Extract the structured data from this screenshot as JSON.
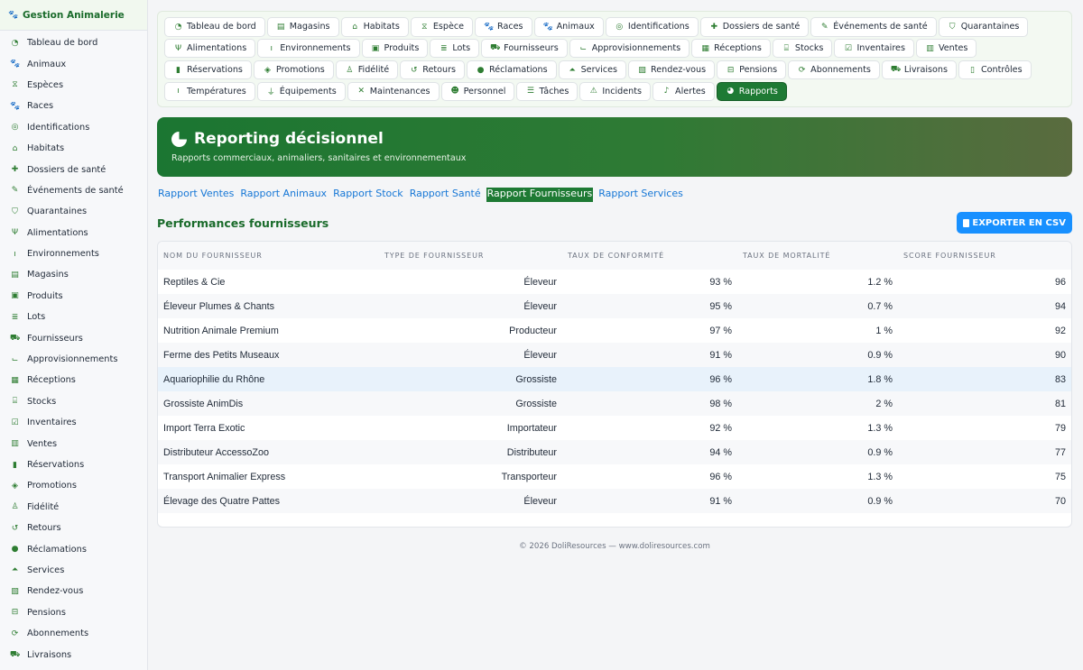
{
  "app": {
    "title": "Gestion Animalerie"
  },
  "sidebar": {
    "items": [
      {
        "label": "Tableau de bord",
        "icon": "dashboard-icon"
      },
      {
        "label": "Animaux",
        "icon": "paw-icon"
      },
      {
        "label": "Espèces",
        "icon": "dna-icon"
      },
      {
        "label": "Races",
        "icon": "paw-icon"
      },
      {
        "label": "Identifications",
        "icon": "fingerprint-icon"
      },
      {
        "label": "Habitats",
        "icon": "home-icon"
      },
      {
        "label": "Dossiers de santé",
        "icon": "medkit-icon"
      },
      {
        "label": "Événements de santé",
        "icon": "syringe-icon"
      },
      {
        "label": "Quarantaines",
        "icon": "shield-icon"
      },
      {
        "label": "Alimentations",
        "icon": "utensils-icon"
      },
      {
        "label": "Environnements",
        "icon": "thermometer-icon"
      },
      {
        "label": "Magasins",
        "icon": "store-icon"
      },
      {
        "label": "Produits",
        "icon": "box-icon"
      },
      {
        "label": "Lots",
        "icon": "layers-icon"
      },
      {
        "label": "Fournisseurs",
        "icon": "truck-icon"
      },
      {
        "label": "Approvisionnements",
        "icon": "dolly-icon"
      },
      {
        "label": "Réceptions",
        "icon": "boxes-icon"
      },
      {
        "label": "Stocks",
        "icon": "warehouse-icon"
      },
      {
        "label": "Inventaires",
        "icon": "clipboard-check-icon"
      },
      {
        "label": "Ventes",
        "icon": "cash-icon"
      },
      {
        "label": "Réservations",
        "icon": "bookmark-icon"
      },
      {
        "label": "Promotions",
        "icon": "tags-icon"
      },
      {
        "label": "Fidélité",
        "icon": "user-heart-icon"
      },
      {
        "label": "Retours",
        "icon": "undo-icon"
      },
      {
        "label": "Réclamations",
        "icon": "comment-icon"
      },
      {
        "label": "Services",
        "icon": "bell-concierge-icon"
      },
      {
        "label": "Rendez-vous",
        "icon": "calendar-check-icon"
      },
      {
        "label": "Pensions",
        "icon": "bed-icon"
      },
      {
        "label": "Abonnements",
        "icon": "sync-icon"
      },
      {
        "label": "Livraisons",
        "icon": "shipping-icon"
      }
    ]
  },
  "topnav": {
    "items": [
      {
        "label": "Tableau de bord",
        "icon": "dashboard-icon"
      },
      {
        "label": "Magasins",
        "icon": "store-icon"
      },
      {
        "label": "Habitats",
        "icon": "home-icon"
      },
      {
        "label": "Espèce",
        "icon": "dna-icon"
      },
      {
        "label": "Races",
        "icon": "paw-icon"
      },
      {
        "label": "Animaux",
        "icon": "paw-icon"
      },
      {
        "label": "Identifications",
        "icon": "fingerprint-icon"
      },
      {
        "label": "Dossiers de santé",
        "icon": "medkit-icon"
      },
      {
        "label": "Événements de santé",
        "icon": "syringe-icon"
      },
      {
        "label": "Quarantaines",
        "icon": "shield-icon"
      },
      {
        "label": "Alimentations",
        "icon": "utensils-icon"
      },
      {
        "label": "Environnements",
        "icon": "thermometer-icon"
      },
      {
        "label": "Produits",
        "icon": "box-icon"
      },
      {
        "label": "Lots",
        "icon": "layers-icon"
      },
      {
        "label": "Fournisseurs",
        "icon": "truck-icon"
      },
      {
        "label": "Approvisionnements",
        "icon": "dolly-icon"
      },
      {
        "label": "Réceptions",
        "icon": "boxes-icon"
      },
      {
        "label": "Stocks",
        "icon": "warehouse-icon"
      },
      {
        "label": "Inventaires",
        "icon": "clipboard-check-icon"
      },
      {
        "label": "Ventes",
        "icon": "cash-icon"
      },
      {
        "label": "Réservations",
        "icon": "bookmark-icon"
      },
      {
        "label": "Promotions",
        "icon": "tags-icon"
      },
      {
        "label": "Fidélité",
        "icon": "user-heart-icon"
      },
      {
        "label": "Retours",
        "icon": "undo-icon"
      },
      {
        "label": "Réclamations",
        "icon": "comment-icon"
      },
      {
        "label": "Services",
        "icon": "bell-concierge-icon"
      },
      {
        "label": "Rendez-vous",
        "icon": "calendar-check-icon"
      },
      {
        "label": "Pensions",
        "icon": "bed-icon"
      },
      {
        "label": "Abonnements",
        "icon": "sync-icon"
      },
      {
        "label": "Livraisons",
        "icon": "shipping-icon"
      },
      {
        "label": "Contrôles",
        "icon": "clipboard-icon"
      },
      {
        "label": "Températures",
        "icon": "thermometer-icon"
      },
      {
        "label": "Équipements",
        "icon": "plug-icon"
      },
      {
        "label": "Maintenances",
        "icon": "tools-icon"
      },
      {
        "label": "Personnel",
        "icon": "users-icon"
      },
      {
        "label": "Tâches",
        "icon": "tasks-icon"
      },
      {
        "label": "Incidents",
        "icon": "warning-icon"
      },
      {
        "label": "Alertes",
        "icon": "bell-icon"
      },
      {
        "label": "Rapports",
        "icon": "chart-pie-icon"
      }
    ],
    "active_index": 38
  },
  "hero": {
    "title": "Reporting décisionnel",
    "subtitle": "Rapports commerciaux, animaliers, sanitaires et environnementaux"
  },
  "report_tabs": {
    "items": [
      "Rapport Ventes",
      "Rapport Animaux",
      "Rapport Stock",
      "Rapport Santé",
      "Rapport Fournisseurs",
      "Rapport Services"
    ],
    "active_index": 4
  },
  "section": {
    "title": "Performances fournisseurs",
    "export_label": "EXPORTER EN CSV"
  },
  "table": {
    "headers": [
      "NOM DU FOURNISSEUR",
      "TYPE DE FOURNISSEUR",
      "TAUX DE CONFORMITÉ",
      "TAUX DE MORTALITÉ",
      "SCORE FOURNISSEUR"
    ],
    "highlighted_row": 4,
    "rows": [
      [
        "Reptiles & Cie",
        "Éleveur",
        "93 %",
        "1.2 %",
        "96"
      ],
      [
        "Éleveur Plumes & Chants",
        "Éleveur",
        "95 %",
        "0.7 %",
        "94"
      ],
      [
        "Nutrition Animale Premium",
        "Producteur",
        "97 %",
        "1 %",
        "92"
      ],
      [
        "Ferme des Petits Museaux",
        "Éleveur",
        "91 %",
        "0.9 %",
        "90"
      ],
      [
        "Aquariophilie du Rhône",
        "Grossiste",
        "96 %",
        "1.8 %",
        "83"
      ],
      [
        "Grossiste AnimDis",
        "Grossiste",
        "98 %",
        "2 %",
        "81"
      ],
      [
        "Import Terra Exotic",
        "Importateur",
        "92 %",
        "1.3 %",
        "79"
      ],
      [
        "Distributeur AccessoZoo",
        "Distributeur",
        "94 %",
        "0.9 %",
        "77"
      ],
      [
        "Transport Animalier Express",
        "Transporteur",
        "96 %",
        "1.3 %",
        "75"
      ],
      [
        "Élevage des Quatre Pattes",
        "Éleveur",
        "91 %",
        "0.9 %",
        "70"
      ]
    ]
  },
  "footer": {
    "text": "© 2026 DoliResources — www.doliresources.com"
  },
  "colors": {
    "brand": "#1e7a34",
    "link": "#1677d6",
    "export": "#1890ff",
    "row_highlight": "#e8f2fb"
  }
}
